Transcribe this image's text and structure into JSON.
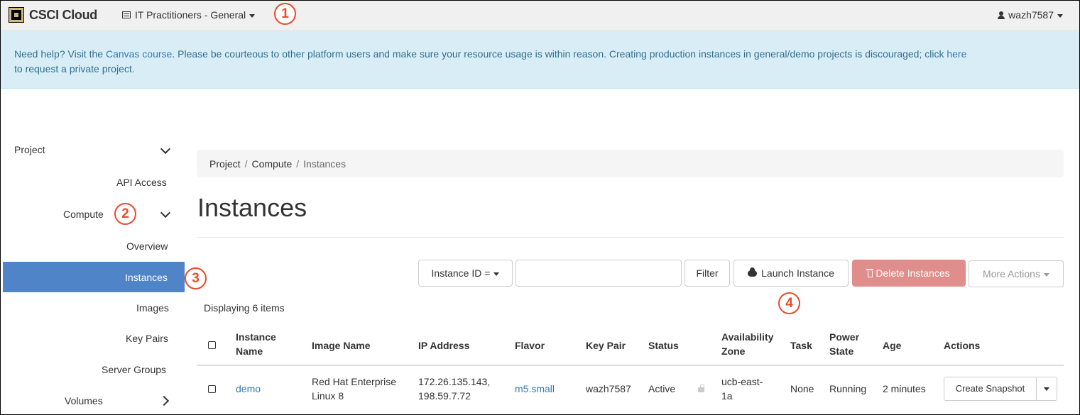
{
  "navbar": {
    "brand": "CSCI Cloud",
    "project": "IT Practitioners - General",
    "user": "wazh7587"
  },
  "banner": {
    "prefix": "Need help? Visit the ",
    "canvas_link": "Canvas course",
    "middle": ". Please be courteous to other platform users and make sure your resource usage is within reason. Creating production instances in general/demo projects is discouraged; click ",
    "here_link": "here",
    "line2": "to request a private project."
  },
  "callouts": [
    "1",
    "2",
    "3",
    "4"
  ],
  "sidebar": {
    "project": "Project",
    "api_access": "API Access",
    "compute": "Compute",
    "overview": "Overview",
    "instances": "Instances",
    "images": "Images",
    "key_pairs": "Key Pairs",
    "server_groups": "Server Groups",
    "volumes": "Volumes"
  },
  "breadcrumb": [
    "Project",
    "Compute",
    "Instances"
  ],
  "page_title": "Instances",
  "toolbar": {
    "filter_field": "Instance ID =",
    "filter_value": "",
    "filter_button": "Filter",
    "launch_button": "Launch Instance",
    "delete_button": "Delete Instances",
    "more_actions": "More Actions"
  },
  "displaying": "Displaying 6 items",
  "table": {
    "headers": {
      "instance_name": [
        "Instance",
        "Name"
      ],
      "image_name": "Image Name",
      "ip_address": "IP Address",
      "flavor": "Flavor",
      "key_pair": "Key Pair",
      "status": "Status",
      "availability_zone": [
        "Availability",
        "Zone"
      ],
      "task": "Task",
      "power_state": [
        "Power",
        "State"
      ],
      "age": "Age",
      "actions": "Actions"
    },
    "rows": [
      {
        "instance_name": "demo",
        "image_name": [
          "Red Hat Enterprise",
          "Linux 8"
        ],
        "ip_address": [
          "172.26.135.143,",
          "198.59.7.72"
        ],
        "flavor": "m5.small",
        "key_pair": "wazh7587",
        "status": "Active",
        "availability_zone": [
          "ucb-east-",
          "1a"
        ],
        "task": "None",
        "power_state": "Running",
        "age": "2 minutes",
        "action": "Create Snapshot"
      }
    ]
  },
  "colors": {
    "accent": "#5084c9",
    "link": "#337ab7",
    "callout": "#e84c2b",
    "danger": "#e08e8b",
    "banner_bg": "#d9edf7"
  }
}
